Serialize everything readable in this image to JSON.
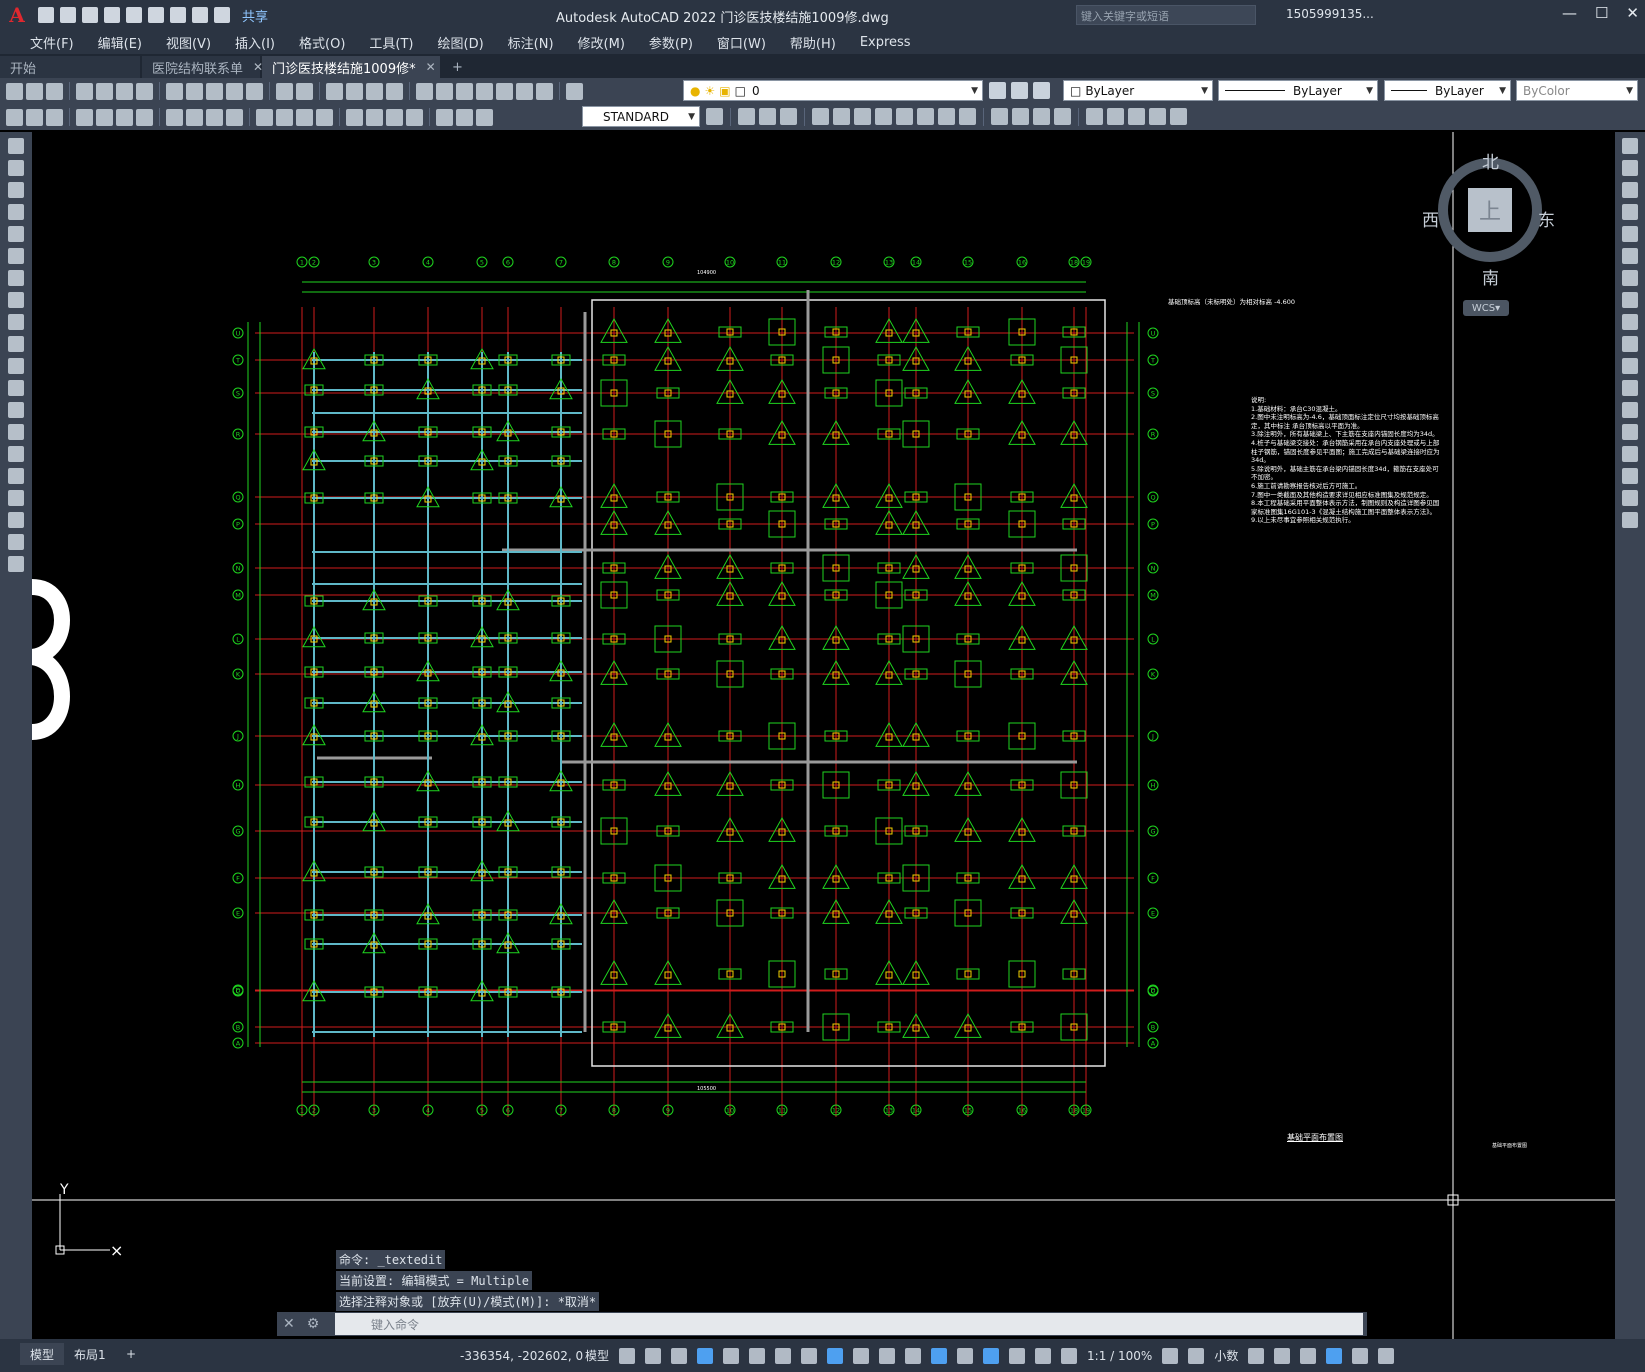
{
  "app": {
    "title": "Autodesk AutoCAD 2022    门诊医技楼结施1009修.dwg",
    "logo": "A",
    "share_label": "共享",
    "search_placeholder": "键入关键字或短语",
    "user": "1505999135...",
    "colors": {
      "accent": "#e0282f",
      "chrome": "#2b3442",
      "panel": "#3b4453"
    }
  },
  "menu": [
    "文件(F)",
    "编辑(E)",
    "视图(V)",
    "插入(I)",
    "格式(O)",
    "工具(T)",
    "绘图(D)",
    "标注(N)",
    "修改(M)",
    "参数(P)",
    "窗口(W)",
    "帮助(H)",
    "Express"
  ],
  "tabs": [
    {
      "label": "开始"
    },
    {
      "label": "医院结构联系单"
    },
    {
      "label": "门诊医技楼结施1009修*"
    }
  ],
  "properties": {
    "layer": "0",
    "color": "ByLayer",
    "linetype": "ByLayer",
    "lineweight": "ByLayer",
    "plotstyle": "ByColor",
    "textstyle": "STANDARD"
  },
  "viewcube": {
    "north": "北",
    "south": "南",
    "east": "东",
    "west": "西",
    "face": "上",
    "wcs": "WCS"
  },
  "drawing": {
    "annotation": "基础顶标高（未标明处）为相对标高 -4.600",
    "plan_title": "基础平面布置图",
    "plan_title_small": "基础平面布置图",
    "dim_top": "104900",
    "dim_bottom": "105500",
    "column_axes": [
      "1",
      "2",
      "3",
      "4",
      "5",
      "6",
      "7",
      "8",
      "9",
      "10",
      "11",
      "12",
      "13",
      "14",
      "15",
      "16",
      "18",
      "19"
    ],
    "row_axes": [
      "A",
      "B",
      "C",
      "D",
      "E",
      "F",
      "G",
      "H",
      "J",
      "K",
      "L",
      "M",
      "N",
      "P",
      "Q",
      "R",
      "S",
      "T",
      "U"
    ],
    "notes_title": "说明:",
    "notes": [
      "1.基础材料：承台C30混凝土。",
      "2.图中未注明标高为-4.6，基础顶面标注定位尺寸均按基础顶标高定，其中标注 承台顶标高以平面为准。",
      "3.除注明外，所有基础梁上、下主筋在支座内锚固长度均为34d。",
      "4.桩子与基础梁交接处：承台钢筋采用在承台内支座处理或与上部柱子钢筋，锚固长度参见平面图；施工完成后与基础梁连接时应为34d。",
      "5.除说明外，基础主筋在承台梁内锚固长度34d，箍筋在支座处可不加密。",
      "6.施工前请勘察报告核对后方可施工。",
      "7.图中一类截面及其他构造要求详见相应标准图集及规范规定。",
      "8.本工程基础采用平面整体表示方法，制图规则及构造详图参见国家标准图集16G101-3《混凝土结构施工图平面整体表示方法》。",
      "9.以上未尽事宜参照相关规范执行。"
    ]
  },
  "command": {
    "history": [
      "命令: _textedit",
      "当前设置: 编辑模式 = Multiple",
      "选择注释对象或 [放弃(U)/模式(M)]: *取消*"
    ],
    "placeholder": "键入命令"
  },
  "status": {
    "layout_tabs": [
      "模型",
      "布局1"
    ],
    "coordinates": "-336354, -202602, 0",
    "model_label": "模型",
    "scale": "1:1 / 100%",
    "units": "小数"
  }
}
